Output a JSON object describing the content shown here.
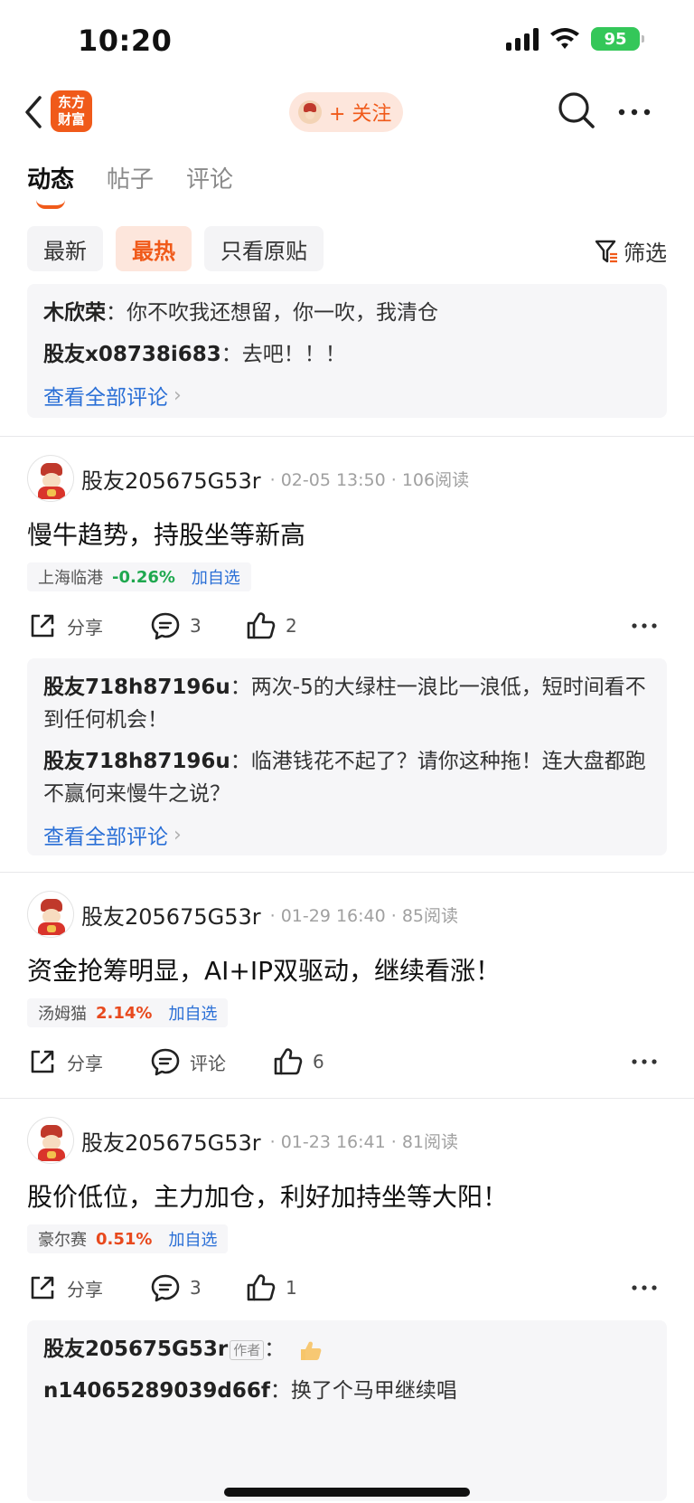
{
  "status_bar": {
    "time": "10:20",
    "battery": "95"
  },
  "nav": {
    "app_logo_line1": "东方",
    "app_logo_line2": "财富",
    "follow_label": "+ 关注"
  },
  "tabs": [
    {
      "label": "动态"
    },
    {
      "label": "帖子"
    },
    {
      "label": "评论"
    }
  ],
  "filters": {
    "items": [
      {
        "label": "最新"
      },
      {
        "label": "最热"
      },
      {
        "label": "只看原贴"
      }
    ],
    "filter_label": "筛选"
  },
  "top_comments": {
    "lines": [
      {
        "user": "木欣荣",
        "text": "：你不吹我还想留，你一吹，我清仓"
      },
      {
        "user": "股友x08738i683",
        "text": "：去吧！！！"
      }
    ],
    "view_all": "查看全部评论"
  },
  "posts": [
    {
      "user": "股友205675G53r",
      "meta": "· 02-05 13:50 · 106阅读",
      "title": "慢牛趋势，持股坐等新高",
      "stock": {
        "name": "上海临港",
        "pct": "-0.26%",
        "add": "加自选"
      },
      "share": "分享",
      "comment": "3",
      "like": "2",
      "comments": [
        {
          "user": "股友718h87196u",
          "text": "：两次-5的大绿柱一浪比一浪低，短时间看不到任何机会！"
        },
        {
          "user": "股友718h87196u",
          "text": "：临港钱花不起了？请你这种拖！连大盘都跑不赢何来慢牛之说？"
        }
      ],
      "view_all": "查看全部评论"
    },
    {
      "user": "股友205675G53r",
      "meta": "· 01-29 16:40 · 85阅读",
      "title": "资金抢筹明显，AI+IP双驱动，继续看涨！",
      "stock": {
        "name": "汤姆猫",
        "pct": "2.14%",
        "add": "加自选"
      },
      "share": "分享",
      "comment": "评论",
      "like": "6"
    },
    {
      "user": "股友205675G53r",
      "meta": "· 01-23 16:41 · 81阅读",
      "title": "股价低位，主力加仓，利好加持坐等大阳！",
      "stock": {
        "name": "豪尔赛",
        "pct": "0.51%",
        "add": "加自选"
      },
      "share": "分享",
      "comment": "3",
      "like": "1",
      "comments": [
        {
          "user": "股友205675G53r",
          "badge": "作者",
          "text": "："
        },
        {
          "user": "n14065289039d66f",
          "text": "：换了个马甲继续唱"
        }
      ]
    }
  ],
  "colors": {
    "accent": "#f05a1a",
    "link": "#2a6fd6",
    "down": "#1fa84f",
    "up": "#e8491d"
  }
}
